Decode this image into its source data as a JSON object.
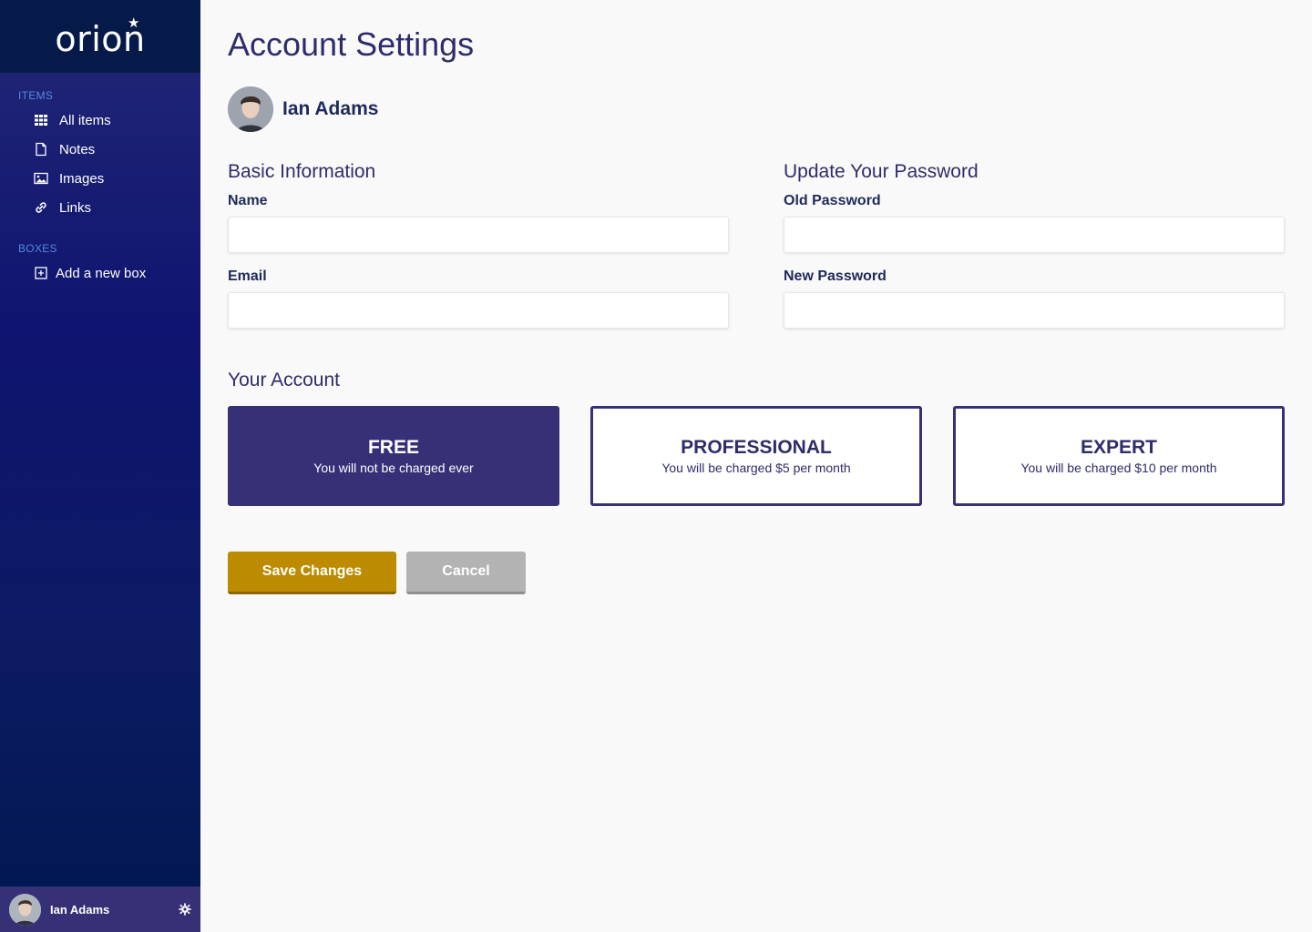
{
  "app": {
    "logo_text": "orion"
  },
  "sidebar": {
    "items_section": {
      "title": "ITEMS"
    },
    "items": [
      {
        "label": "All items",
        "icon": "grid-icon"
      },
      {
        "label": "Notes",
        "icon": "document-icon"
      },
      {
        "label": "Images",
        "icon": "image-icon"
      },
      {
        "label": "Links",
        "icon": "link-icon"
      }
    ],
    "boxes_section": {
      "title": "BOXES"
    },
    "boxes": [
      {
        "label": "Add a new box",
        "icon": "plus-square-icon"
      }
    ],
    "user": {
      "name": "Ian Adams"
    }
  },
  "main": {
    "title": "Account Settings",
    "profile": {
      "name": "Ian Adams"
    },
    "basic_info": {
      "title": "Basic Information",
      "name_label": "Name",
      "name_value": "",
      "email_label": "Email",
      "email_value": ""
    },
    "password": {
      "title": "Update Your Password",
      "old_label": "Old Password",
      "old_value": "",
      "new_label": "New Password",
      "new_value": ""
    },
    "account": {
      "title": "Your Account",
      "plans": [
        {
          "name": "FREE",
          "description": "You will not be charged ever",
          "selected": true
        },
        {
          "name": "PROFESSIONAL",
          "description": "You will be charged $5 per month",
          "selected": false
        },
        {
          "name": "EXPERT",
          "description": "You will be charged $10 per month",
          "selected": false
        }
      ]
    },
    "actions": {
      "save_label": "Save Changes",
      "cancel_label": "Cancel"
    }
  },
  "colors": {
    "primary": "#363077",
    "accent_gold": "#bd8b00",
    "sidebar_top": "#061a4a",
    "section_label": "#4f8be0",
    "cancel_gray": "#b3b3b3"
  }
}
